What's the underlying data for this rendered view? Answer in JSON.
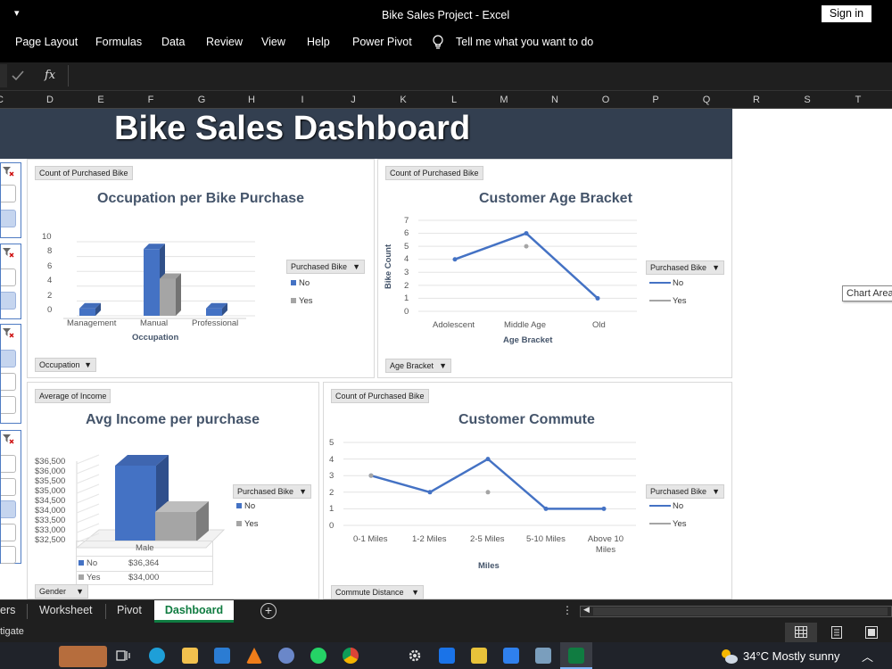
{
  "window": {
    "menu_glyph": "▾",
    "title": "Bike Sales Project  -  Excel",
    "sign_in": "Sign in"
  },
  "ribbon": {
    "tabs": [
      "Page Layout",
      "Formulas",
      "Data",
      "Review",
      "View",
      "Help",
      "Power Pivot"
    ],
    "tell_me": "Tell me what you want to do"
  },
  "formula_bar": {
    "fx": "fx"
  },
  "columns": [
    "C",
    "D",
    "E",
    "F",
    "G",
    "H",
    "I",
    "J",
    "K",
    "L",
    "M",
    "N",
    "O",
    "P",
    "Q",
    "R",
    "S",
    "T"
  ],
  "dashboard": {
    "title": "Bike Sales Dashboard",
    "tooltip": "Chart Area"
  },
  "charts": {
    "occupation": {
      "field_pill": "Count of Purchased Bike",
      "title": "Occupation per Bike Purchase",
      "xlabel": "Occupation",
      "axis_pill": "Occupation",
      "legend_title": "Purchased Bike",
      "legend": [
        "No",
        "Yes"
      ],
      "yticks": [
        "10",
        "8",
        "6",
        "4",
        "2",
        "0"
      ]
    },
    "age": {
      "field_pill": "Count of Purchased Bike",
      "title": "Customer Age Bracket",
      "ylabel": "Bike Count",
      "xlabel": "Age Bracket",
      "axis_pill": "Age Bracket",
      "legend_title": "Purchased Bike",
      "legend": [
        "No",
        "Yes"
      ],
      "yticks": [
        "7",
        "6",
        "5",
        "4",
        "3",
        "2",
        "1",
        "0"
      ]
    },
    "income": {
      "field_pill": "Average of Income",
      "title": "Avg Income per purchase",
      "axis_pill": "Gender",
      "legend_title": "Purchased Bike",
      "legend": [
        "No",
        "Yes"
      ],
      "yticks": [
        "$36,500",
        "$36,000",
        "$35,500",
        "$35,000",
        "$34,500",
        "$34,000",
        "$33,500",
        "$33,000",
        "$32,500"
      ],
      "table_header": "Male",
      "table_rows": [
        {
          "label": "No",
          "value": "$36,364"
        },
        {
          "label": "Yes",
          "value": "$34,000"
        }
      ]
    },
    "commute": {
      "field_pill": "Count of Purchased Bike",
      "title": "Customer Commute",
      "xlabel": "Miles",
      "axis_pill": "Commute Distance",
      "legend_title": "Purchased Bike",
      "legend": [
        "No",
        "Yes"
      ],
      "yticks": [
        "5",
        "4",
        "3",
        "2",
        "1",
        "0"
      ]
    }
  },
  "chart_data": [
    {
      "type": "bar",
      "title": "Occupation per Bike Purchase",
      "xlabel": "Occupation",
      "categories": [
        "Management",
        "Manual",
        "Professional"
      ],
      "series": [
        {
          "name": "No",
          "values": [
            1,
            9,
            1
          ]
        },
        {
          "name": "Yes",
          "values": [
            0,
            5,
            0
          ]
        }
      ],
      "ylim": [
        0,
        10
      ]
    },
    {
      "type": "line",
      "title": "Customer Age Bracket",
      "xlabel": "Age Bracket",
      "ylabel": "Bike Count",
      "categories": [
        "Adolescent",
        "Middle Age",
        "Old"
      ],
      "series": [
        {
          "name": "No",
          "values": [
            4,
            6,
            1
          ]
        },
        {
          "name": "Yes",
          "values": [
            null,
            5,
            null
          ]
        }
      ],
      "ylim": [
        0,
        7
      ]
    },
    {
      "type": "bar",
      "title": "Avg Income per purchase",
      "categories": [
        "Male"
      ],
      "series": [
        {
          "name": "No",
          "values": [
            36364
          ]
        },
        {
          "name": "Yes",
          "values": [
            34000
          ]
        }
      ],
      "ylim": [
        32500,
        36500
      ]
    },
    {
      "type": "line",
      "title": "Customer Commute",
      "xlabel": "Miles",
      "categories": [
        "0-1 Miles",
        "1-2 Miles",
        "2-5 Miles",
        "5-10 Miles",
        "Above 10 Miles"
      ],
      "series": [
        {
          "name": "No",
          "values": [
            3,
            2,
            4,
            1,
            1
          ]
        },
        {
          "name": "Yes",
          "values": [
            3,
            null,
            2,
            null,
            null
          ]
        }
      ],
      "ylim": [
        0,
        5
      ]
    }
  ],
  "sheet_tabs": {
    "partial": "ers",
    "tabs": [
      "Worksheet",
      "Pivot",
      "Dashboard"
    ],
    "active": "Dashboard",
    "add": "+"
  },
  "status": {
    "text": "tigate"
  },
  "taskbar": {
    "weather": "34°C  Mostly sunny"
  },
  "colors": {
    "series_no": "#4472c4",
    "series_yes": "#a5a5a5",
    "banner": "#333f50",
    "title_text": "#44546a",
    "active_tab": "#107c41"
  }
}
